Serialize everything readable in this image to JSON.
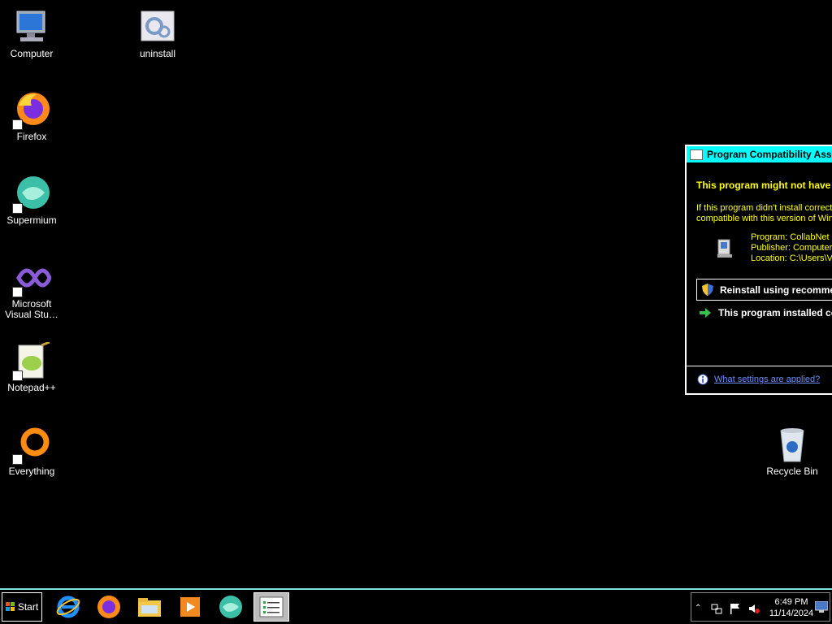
{
  "desktop": {
    "icons": [
      {
        "label": "Computer",
        "icon": "computer-icon"
      },
      {
        "label": "uninstall",
        "icon": "uninstall-icon"
      },
      {
        "label": "Firefox",
        "icon": "firefox-icon"
      },
      {
        "label": "Supermium",
        "icon": "supermium-icon"
      },
      {
        "label": "Microsoft\nVisual Stu…",
        "icon": "visual-studio-icon"
      },
      {
        "label": "Notepad++",
        "icon": "notepadpp-icon"
      },
      {
        "label": "Everything",
        "icon": "everything-icon"
      },
      {
        "label": "Recycle Bin",
        "icon": "recycle-bin-icon"
      }
    ]
  },
  "dialog": {
    "title": "Program Compatibility Assistant",
    "heading": "This program might not have installed correctly",
    "desc_line1": "If this program didn't install correctly, try reinstalling using settings that are",
    "desc_line2": "compatible with this version of Windows.",
    "program": "Program: CollabNet CVSNT",
    "publisher": "Publisher: Computer",
    "location": "Location: C:\\Users\\Vagrant",
    "option_reinstall": "Reinstall using recommended settings",
    "option_installed": "This program installed correctly",
    "settings_link": "What settings are applied?"
  },
  "taskbar": {
    "start_label": "Start",
    "apps": [
      "internet-explorer-icon",
      "firefox-icon",
      "file-explorer-icon",
      "media-player-icon",
      "supermium-icon",
      "program-compatibility-icon"
    ],
    "clock_time": "6:49 PM",
    "clock_date": "11/14/2024"
  },
  "colors": {
    "background": "#000000",
    "dialog_title_bg": "#00ffff",
    "dialog_text": "#ffff00",
    "link": "#6f8cff"
  }
}
